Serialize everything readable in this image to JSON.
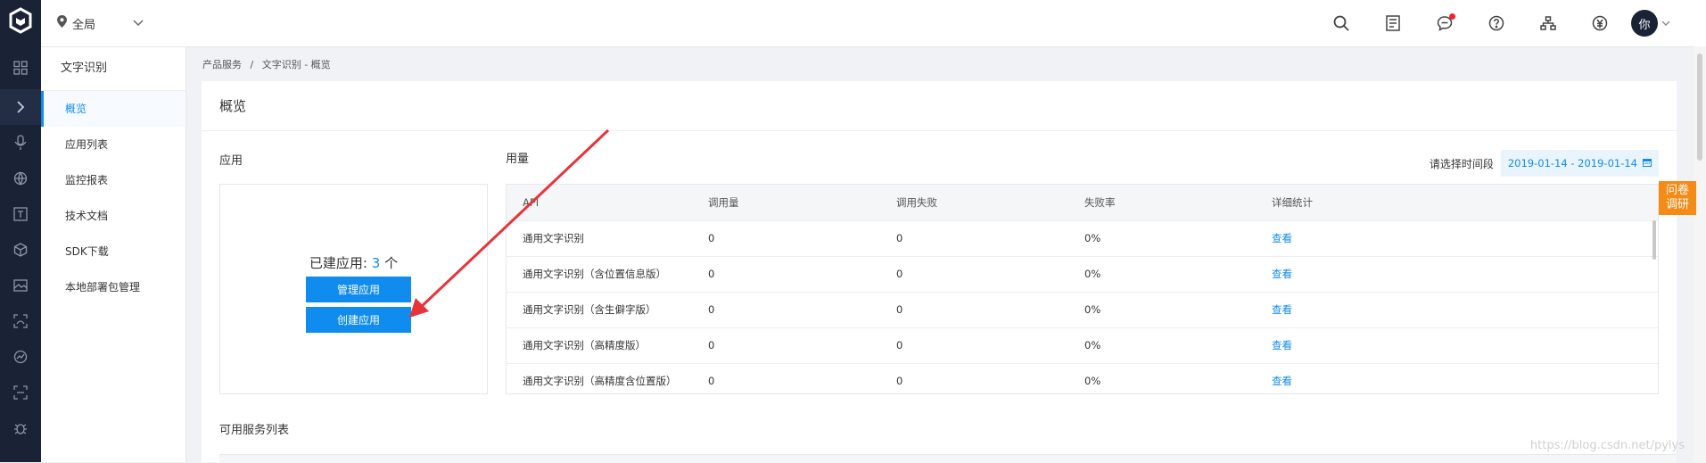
{
  "rail": {
    "icons": [
      "grid-icon",
      "expand-icon",
      "mic-icon",
      "globe-icon",
      "text-icon",
      "cube-icon",
      "image-icon",
      "face-icon",
      "analytics-icon",
      "scan-icon",
      "bug-icon"
    ]
  },
  "topbar": {
    "region": "全局",
    "avatar": "你",
    "icons": [
      "search-icon",
      "orders-icon",
      "messages-icon",
      "help-icon",
      "org-icon",
      "billing-icon"
    ]
  },
  "subnav": {
    "title": "文字识别",
    "items": [
      "概览",
      "应用列表",
      "监控报表",
      "技术文档",
      "SDK下载",
      "本地部署包管理"
    ],
    "active_index": 0
  },
  "breadcrumb": [
    "产品服务",
    "文字识别 - 概览"
  ],
  "page": {
    "title": "概览",
    "app_label": "应用",
    "usage_label": "用量",
    "app_count_prefix": "已建应用: ",
    "app_count": "3",
    "app_count_suffix": " 个",
    "manage_button": "管理应用",
    "create_button": "创建应用",
    "date_label": "请选择时间段",
    "date_range": "2019-01-14 - 2019-01-14",
    "services_label": "可用服务列表"
  },
  "usage_table": {
    "headers": [
      "API",
      "调用量",
      "调用失败",
      "失败率",
      "详细统计"
    ],
    "rows": [
      [
        "通用文字识别",
        "0",
        "0",
        "0%",
        "查看"
      ],
      [
        "通用文字识别（含位置信息版）",
        "0",
        "0",
        "0%",
        "查看"
      ],
      [
        "通用文字识别（含生僻字版）",
        "0",
        "0",
        "0%",
        "查看"
      ],
      [
        "通用文字识别（高精度版）",
        "0",
        "0",
        "0%",
        "查看"
      ],
      [
        "通用文字识别（高精度含位置版）",
        "0",
        "0",
        "0%",
        "查看"
      ]
    ]
  },
  "survey": [
    "问卷",
    "调研"
  ],
  "watermark": "https://blog.csdn.net/pylys",
  "colors": {
    "accent": "#108cee",
    "rail": "#1a2236",
    "survey": "#f38b16",
    "arrow": "#e8333a"
  }
}
